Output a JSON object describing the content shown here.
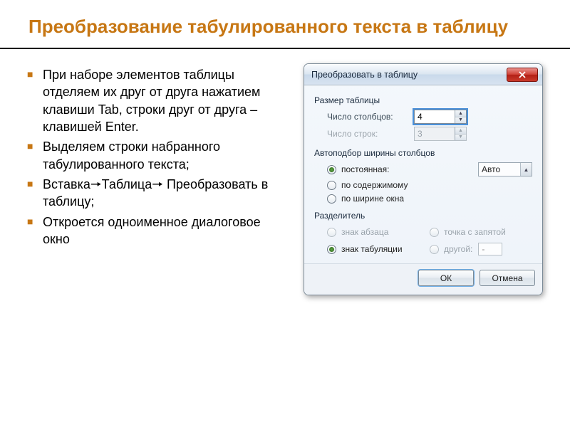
{
  "slide": {
    "title": "Преобразование табулированного текста в таблицу",
    "bullets": [
      "При наборе элементов таблицы отделяем их друг от друга нажатием клавиши Tab, строки друг от друга – клавишей Enter.",
      "Выделяем строки набранного табулированного текста;",
      "Вставка🠖Таблица🠖 Преобразовать в таблицу;",
      "Откроется одноименное диалоговое окно"
    ]
  },
  "dialog": {
    "title": "Преобразовать в таблицу",
    "size_group": "Размер таблицы",
    "cols_label": "Число столбцов:",
    "cols_value": "4",
    "rows_label": "Число строк:",
    "rows_value": "3",
    "autofit_group": "Автоподбор ширины столбцов",
    "autofit_fixed": "постоянная:",
    "autofit_fixed_value": "Авто",
    "autofit_content": "по содержимому",
    "autofit_window": "по ширине окна",
    "sep_group": "Разделитель",
    "sep_para": "знак абзаца",
    "sep_semicolon": "точка с запятой",
    "sep_tab": "знак табуляции",
    "sep_other": "другой:",
    "sep_other_value": "-",
    "ok": "ОК",
    "cancel": "Отмена"
  }
}
